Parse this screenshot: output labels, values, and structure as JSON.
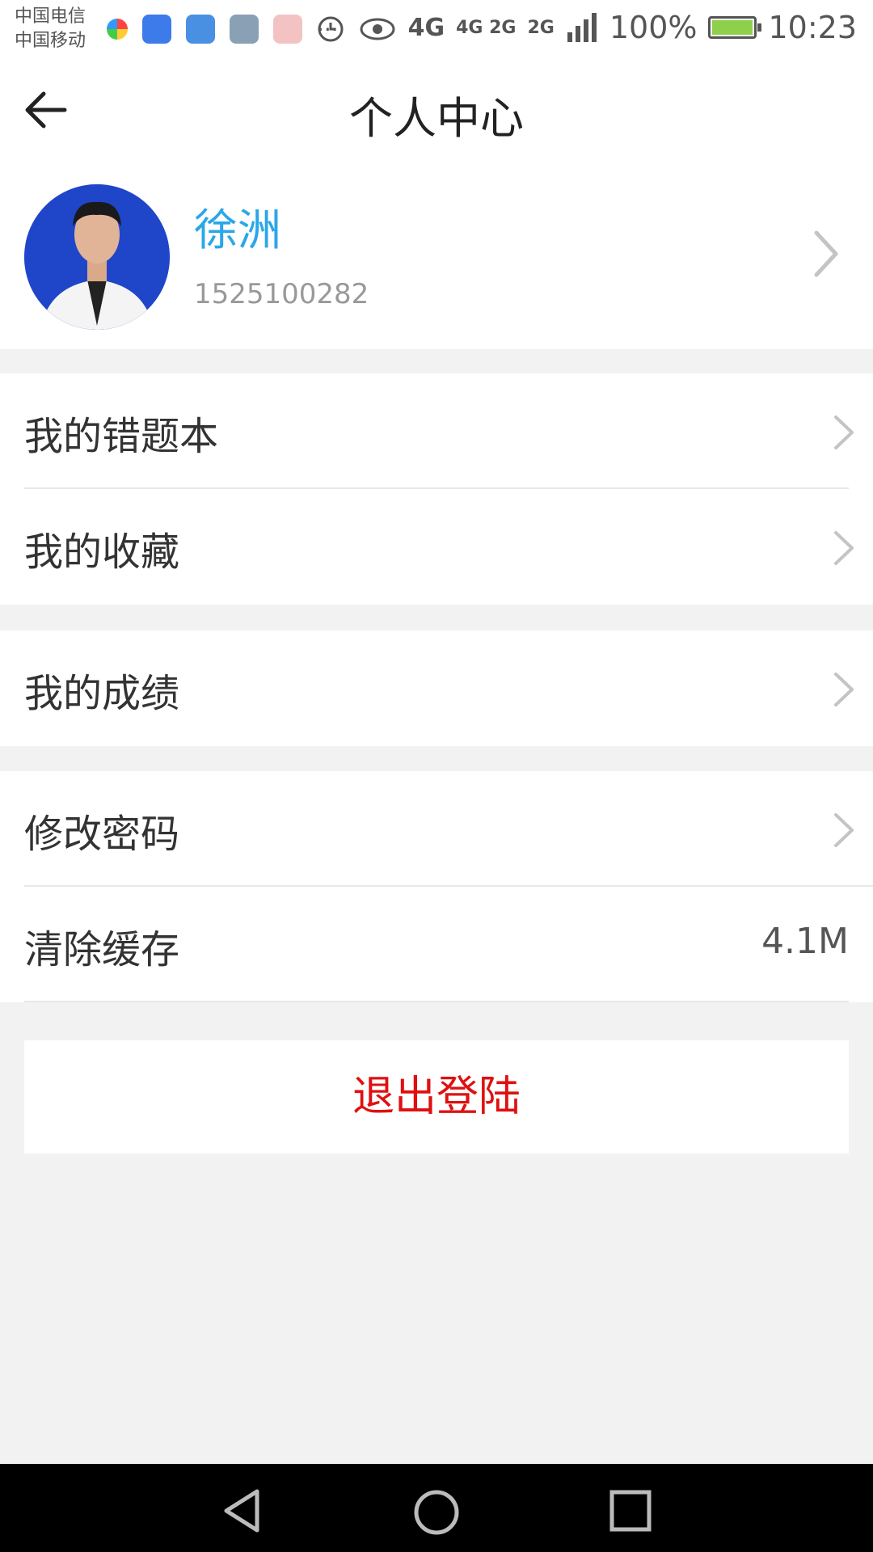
{
  "status_bar": {
    "carrier1": "中国电信",
    "carrier2": "中国移动",
    "more": "···",
    "net1": "4G",
    "net2": "4G 2G",
    "net3": "2G",
    "battery": "100%",
    "time": "10:23",
    "icons": [
      "pinwheel-app-icon",
      "shield-app-icon",
      "health-app-icon",
      "gallery-app-icon",
      "map-pin-app-icon",
      "alarm-icon",
      "eye-icon",
      "signal-icon",
      "battery-icon"
    ]
  },
  "header": {
    "title": "个人中心",
    "back_icon": "back-arrow-icon"
  },
  "profile": {
    "name": "徐洲",
    "phone": "1525100282"
  },
  "menu": {
    "group1": [
      {
        "label": "我的错题本"
      },
      {
        "label": "我的收藏"
      }
    ],
    "group2": [
      {
        "label": "我的成绩"
      }
    ],
    "group3": [
      {
        "label": "修改密码"
      },
      {
        "label": "清除缓存",
        "value": "4.1M"
      }
    ]
  },
  "logout": {
    "label": "退出登陆"
  },
  "colors": {
    "accent": "#2aa7e8",
    "danger": "#e01010",
    "background": "#f2f2f2"
  }
}
